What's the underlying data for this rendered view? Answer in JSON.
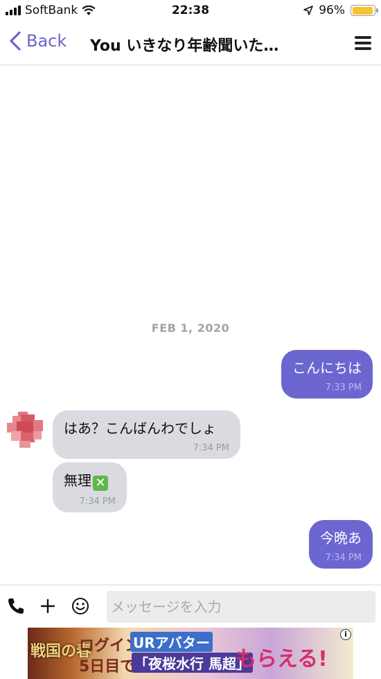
{
  "status_bar": {
    "carrier": "SoftBank",
    "time": "22:38",
    "battery_percent": "96%",
    "battery_level": 0.96
  },
  "nav": {
    "back_label": "Back",
    "title": "You いきなり年齢聞いた…"
  },
  "chat": {
    "date_separator": "FEB 1, 2020",
    "messages": [
      {
        "direction": "outgoing",
        "text": "こんにちは",
        "time": "7:33 PM"
      },
      {
        "direction": "incoming",
        "text": "はあ？こんばんわでしょ",
        "time": "7:34 PM"
      },
      {
        "direction": "incoming",
        "text": "無理",
        "emoji": "cross-mark-button",
        "time": "7:34 PM"
      },
      {
        "direction": "outgoing",
        "text": "今晩あ",
        "time": "7:34 PM"
      }
    ]
  },
  "input": {
    "placeholder": "メッセージを入力",
    "value": ""
  },
  "ad": {
    "line1": "ログイン",
    "tag1": "URアバター",
    "line2": "5日目で、",
    "tag2": "「夜桜水行 馬超」",
    "headline": "もらえる!",
    "logo": "戦国の春",
    "info_label": "i"
  },
  "colors": {
    "accent": "#6c66c9",
    "outgoing_bubble": "#6c66d0",
    "incoming_bubble": "#d9dbe1",
    "battery": "#f5c331"
  }
}
